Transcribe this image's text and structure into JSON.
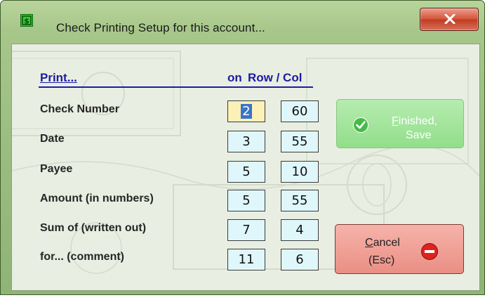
{
  "window": {
    "title": "Check Printing Setup for this account...",
    "icon": "dollar-icon",
    "close_icon": "close-icon"
  },
  "header": {
    "print_label": "Print...",
    "on_label": "on",
    "rowcol_label": "Row / Col"
  },
  "fields": [
    {
      "label": "Check Number",
      "row": "2",
      "col": "60"
    },
    {
      "label": "Date",
      "row": "3",
      "col": "55"
    },
    {
      "label": "Payee",
      "row": "5",
      "col": "10"
    },
    {
      "label": "Amount (in numbers)",
      "row": "5",
      "col": "55"
    },
    {
      "label": "Sum of (written out)",
      "row": "7",
      "col": "4"
    },
    {
      "label": "for... (comment)",
      "row": "11",
      "col": "6"
    }
  ],
  "finish_button": {
    "line1_accel": "F",
    "line1_rest": "inished,",
    "line2": "Save",
    "icon": "checkmark-icon",
    "disabled": true
  },
  "cancel_button": {
    "line1_accel": "C",
    "line1_rest": "ancel",
    "line2": "(Esc)",
    "icon": "stop-icon"
  },
  "colors": {
    "frame": "#9bbd80",
    "header_text": "#1c1ca3",
    "field_bg": "#dff7fb",
    "active_field_bg": "#fbf0b8",
    "finish_bg": "#a5e59c",
    "cancel_bg": "#f0a096"
  }
}
